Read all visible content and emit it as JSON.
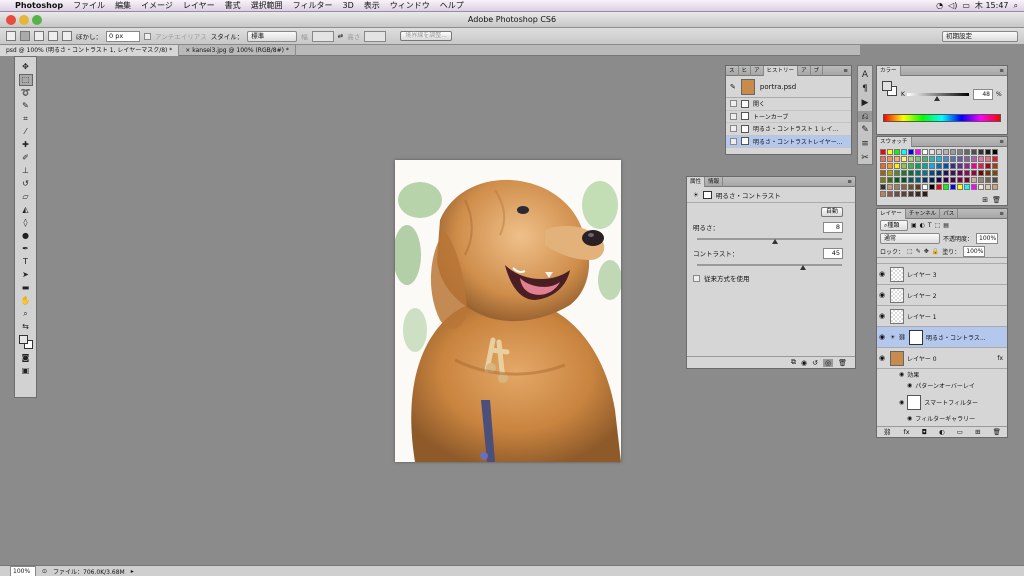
{
  "menubar": {
    "app": "Photoshop",
    "items": [
      "ファイル",
      "編集",
      "イメージ",
      "レイヤー",
      "書式",
      "選択範囲",
      "フィルター",
      "3D",
      "表示",
      "ウィンドウ",
      "ヘルプ"
    ],
    "clock": "木 15:47"
  },
  "window": {
    "title": "Adobe Photoshop CS6"
  },
  "options": {
    "feather_label": "ぼかし：",
    "feather_value": "0 px",
    "antialias_label": "アンチエイリアス",
    "style_label": "スタイル：",
    "style_value": "標準",
    "width_label": "幅",
    "height_label": "高さ",
    "refine_label": "境界線を調整...",
    "workspace": "初期設定"
  },
  "tabs": [
    {
      "label": "psd @ 100% (明るさ・コントラスト 1, レイヤーマスク/8) *",
      "active": true
    },
    {
      "label": "kansei3.jpg @ 100% (RGB/8#) *",
      "active": false
    }
  ],
  "history_panel": {
    "tabs": [
      "ス",
      "ヒ",
      "ア",
      "ヒストリー",
      "ア",
      "ブ"
    ],
    "snapshot": "portra.psd",
    "items": [
      {
        "label": "開く",
        "active": false
      },
      {
        "label": "トーンカーブ",
        "active": false
      },
      {
        "label": "明るさ・コントラスト 1 レイ...",
        "active": false
      },
      {
        "label": "明るさ・コントラストレイヤー...",
        "active": true
      }
    ]
  },
  "properties_panel": {
    "tabs": [
      "属性",
      "情報"
    ],
    "title": "明るさ・コントラスト",
    "auto_label": "自動",
    "brightness_label": "明るさ：",
    "brightness_value": "8",
    "brightness_level": 0.54,
    "contrast_label": "コントラスト：",
    "contrast_value": "45",
    "contrast_level": 0.73,
    "legacy_label": "従来方式を使用"
  },
  "color_panel": {
    "title": "カラー",
    "channel": "K",
    "value": "48",
    "unit": "%",
    "level": 0.48
  },
  "swatches_panel": {
    "title": "スウォッチ",
    "colors": [
      "#ff0000",
      "#ffff00",
      "#00ff00",
      "#00ffff",
      "#0000ff",
      "#ff00ff",
      "#ffffff",
      "#e6e6e6",
      "#cccccc",
      "#b3b3b3",
      "#999999",
      "#808080",
      "#666666",
      "#4d4d4d",
      "#333333",
      "#1a1a1a",
      "#000000",
      "#f26c4f",
      "#f68e56",
      "#fbaf5d",
      "#fff467",
      "#acd372",
      "#7cc576",
      "#3bb878",
      "#1abbb4",
      "#00bff3",
      "#438ccb",
      "#5574b9",
      "#605ca8",
      "#855fa8",
      "#a763a8",
      "#f06ea9",
      "#f26d7d",
      "#ed1c24",
      "#f26522",
      "#f7941d",
      "#fff200",
      "#8dc73f",
      "#39b54a",
      "#00a651",
      "#00a99d",
      "#00aeef",
      "#0072bc",
      "#0054a6",
      "#2e3192",
      "#662d91",
      "#92278f",
      "#ec008c",
      "#ed145b",
      "#9e0b0f",
      "#a0410d",
      "#a36209",
      "#aba000",
      "#598527",
      "#1a7b30",
      "#007236",
      "#00746b",
      "#0076a3",
      "#004b80",
      "#003471",
      "#1b1464",
      "#440e62",
      "#630460",
      "#9e005d",
      "#9e0039",
      "#790000",
      "#7b2e00",
      "#7d4900",
      "#827b00",
      "#406618",
      "#005e20",
      "#005826",
      "#005952",
      "#005b7f",
      "#003663",
      "#002157",
      "#0d004c",
      "#32004b",
      "#4b0049",
      "#7b0046",
      "#7a0026",
      "#c7b299",
      "#998675",
      "#736357",
      "#534741",
      "#37302a",
      "#c69c6d",
      "#a67c52",
      "#8c6239",
      "#754c24",
      "#603913",
      "#ffffff",
      "#000000",
      "#ff0000",
      "#00ff00",
      "#0000ff",
      "#ffff00",
      "#00ffff",
      "#ff00ff",
      "#f5e6d0",
      "#e0c9a6",
      "#d4a373",
      "#b5835a",
      "#8a5a44",
      "#6d4c41",
      "#5d4037",
      "#4e342e",
      "#3e2723",
      "#2b1d17"
    ]
  },
  "layers_panel": {
    "tabs": [
      "レイヤー",
      "チャンネル",
      "パス"
    ],
    "filter": "種類",
    "blend_mode": "通常",
    "opacity_label": "不透明度：",
    "opacity_value": "100%",
    "lock_label": "ロック：",
    "fill_label": "塗り：",
    "fill_value": "100%",
    "layers": [
      {
        "name": "レイヤー 3",
        "kind": "pixel",
        "active": false
      },
      {
        "name": "レイヤー 2",
        "kind": "pixel",
        "active": false
      },
      {
        "name": "レイヤー 1",
        "kind": "pixel",
        "active": false
      },
      {
        "name": "明るさ・コントラス...",
        "kind": "adjustment",
        "active": true
      },
      {
        "name": "レイヤー 0",
        "kind": "smart",
        "active": false
      }
    ],
    "effects_label": "効果",
    "pattern_overlay": "パターンオーバーレイ",
    "smart_filter": "スマートフィルター",
    "filter_gallery": "フィルターギャラリー"
  },
  "status": {
    "zoom": "100%",
    "file_label": "ファイル：706.0K/3.68M"
  }
}
